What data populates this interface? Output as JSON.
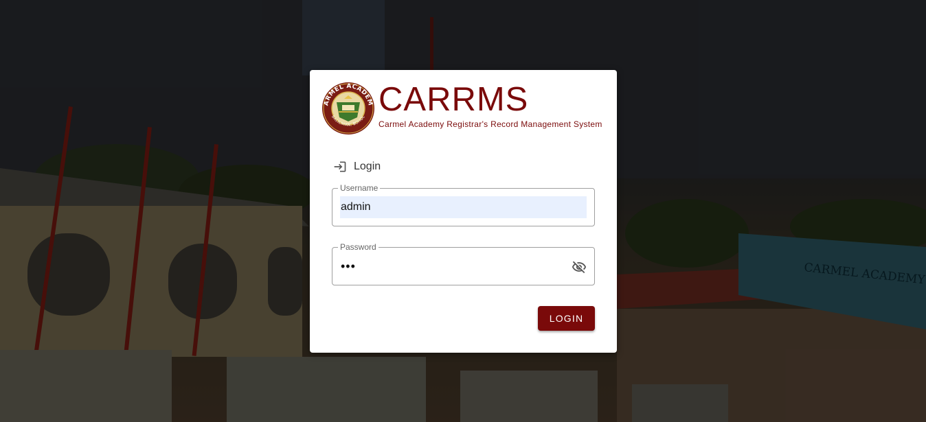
{
  "brand": {
    "title": "CARRMS",
    "subtitle": "Carmel Academy Registrar's Record Management System",
    "logo_icon": "carmel-academy-seal",
    "logo_text_top": "CARMEL ACADEMY",
    "logo_text_bottom": "BALILIHAN, BOHOL",
    "accent_color": "#7a0a0a"
  },
  "login_form": {
    "heading": "Login",
    "heading_icon": "login-icon",
    "username": {
      "label": "Username",
      "value": "admin"
    },
    "password": {
      "label": "Password",
      "value": "•••",
      "toggle_icon": "eye-off-icon"
    },
    "submit_label": "LOGIN"
  },
  "background": {
    "signboard_text": "CARMEL ACADEMY"
  }
}
